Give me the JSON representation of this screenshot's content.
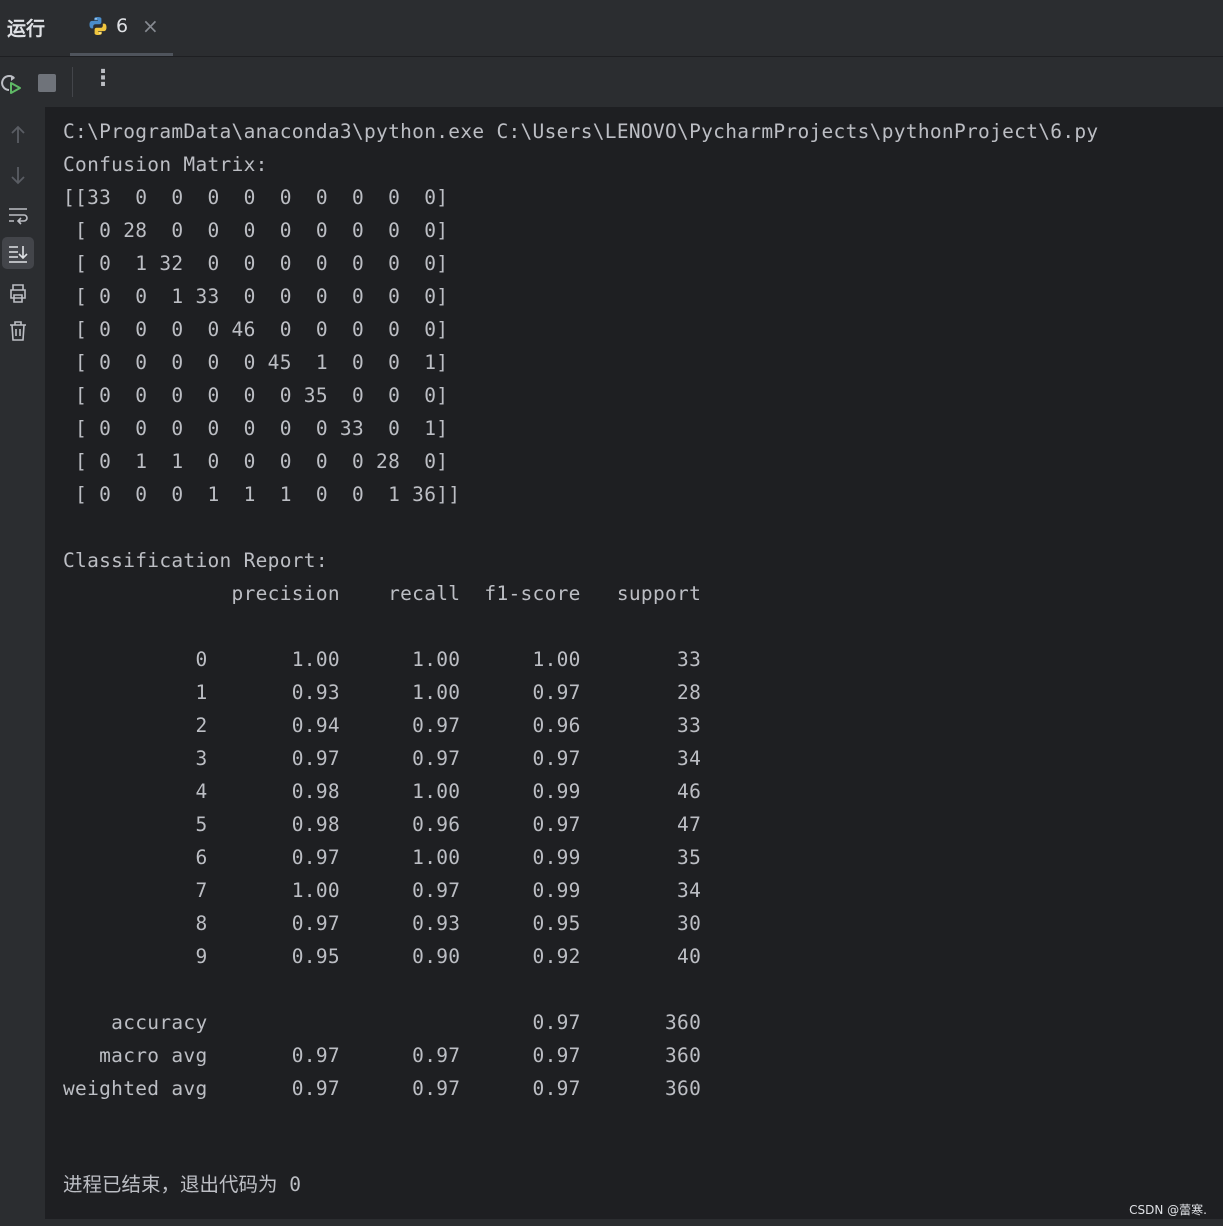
{
  "header": {
    "run_title": "运行",
    "tab_label": "6",
    "tab_close": "×"
  },
  "toolbar": {
    "more_label": "⋮"
  },
  "console": {
    "lines": [
      "C:\\ProgramData\\anaconda3\\python.exe C:\\Users\\LENOVO\\PycharmProjects\\pythonProject\\6.py",
      "Confusion Matrix:",
      "[[33  0  0  0  0  0  0  0  0  0]",
      " [ 0 28  0  0  0  0  0  0  0  0]",
      " [ 0  1 32  0  0  0  0  0  0  0]",
      " [ 0  0  1 33  0  0  0  0  0  0]",
      " [ 0  0  0  0 46  0  0  0  0  0]",
      " [ 0  0  0  0  0 45  1  0  0  1]",
      " [ 0  0  0  0  0  0 35  0  0  0]",
      " [ 0  0  0  0  0  0  0 33  0  1]",
      " [ 0  1  1  0  0  0  0  0 28  0]",
      " [ 0  0  0  1  1  1  0  0  1 36]]",
      "",
      "Classification Report:",
      "              precision    recall  f1-score   support",
      "",
      "           0       1.00      1.00      1.00        33",
      "           1       0.93      1.00      0.97        28",
      "           2       0.94      0.97      0.96        33",
      "           3       0.97      0.97      0.97        34",
      "           4       0.98      1.00      0.99        46",
      "           5       0.98      0.96      0.97        47",
      "           6       0.97      1.00      0.99        35",
      "           7       1.00      0.97      0.99        34",
      "           8       0.97      0.93      0.95        30",
      "           9       0.95      0.90      0.92        40",
      "",
      "    accuracy                           0.97       360",
      "   macro avg       0.97      0.97      0.97       360",
      "weighted avg       0.97      0.97      0.97       360"
    ],
    "exit_message": "进程已结束，退出代码为 0"
  },
  "watermark": "CSDN @蕾寒."
}
